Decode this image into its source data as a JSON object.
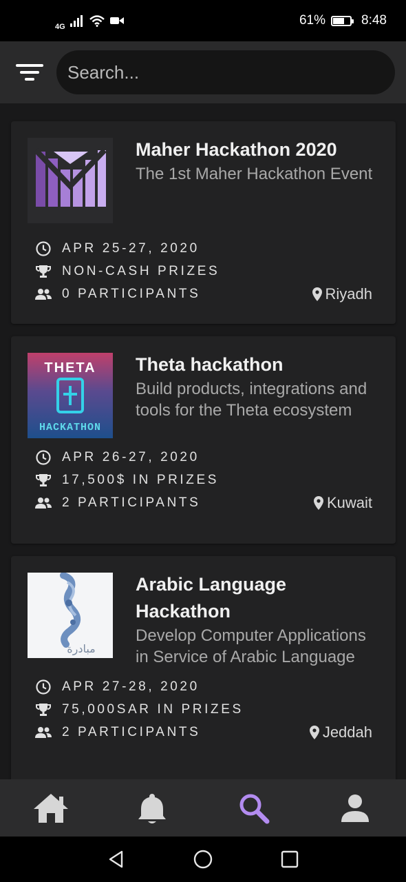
{
  "status_bar": {
    "network": "4G",
    "battery_percent": "61%",
    "time": "8:48"
  },
  "search": {
    "placeholder": "Search..."
  },
  "hackathons": [
    {
      "title": "Maher Hackathon 2020",
      "description": "The 1st Maher Hackathon Event",
      "date": "APR 25-27, 2020",
      "prizes": "NON-CASH PRIZES",
      "participants": "0 PARTICIPANTS",
      "location": "Riyadh"
    },
    {
      "title": "Theta hackathon",
      "description": "Build products, integrations and tools for the Theta ecosystem",
      "date": "APR 26-27, 2020",
      "prizes": "17,500$ IN PRIZES",
      "participants": "2 PARTICIPANTS",
      "location": "Kuwait",
      "logo_text_top": "THETA",
      "logo_text_bottom": "HACKATHON"
    },
    {
      "title": "Arabic Language Hackathon",
      "description": "Develop Computer Applications in Service of Arabic Language",
      "date": "APR 27-28, 2020",
      "prizes": "75,000SAR IN PRIZES",
      "participants": "2 PARTICIPANTS",
      "location": "Jeddah",
      "logo_text": "مبادرة"
    }
  ],
  "bottom_nav": {
    "items": [
      "home-icon",
      "bell-icon",
      "search-icon",
      "person-icon"
    ],
    "active": "search-icon",
    "active_color": "#b38cf0",
    "inactive_color": "#d6d6d6"
  },
  "system_nav": [
    "back-icon",
    "home-circle-icon",
    "recents-icon"
  ]
}
